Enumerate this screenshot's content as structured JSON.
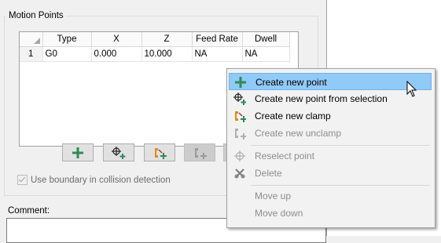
{
  "motion_points": {
    "title": "Motion Points",
    "columns": [
      "Type",
      "X",
      "Z",
      "Feed Rate",
      "Dwell"
    ],
    "rows": [
      {
        "num": "1",
        "type": "G0",
        "x": "0.000",
        "z": "10.000",
        "feed": "NA",
        "dwell": "NA"
      }
    ]
  },
  "toolbar": {
    "buttons": [
      {
        "name": "add-point-button",
        "icon": "plus-icon",
        "enabled": true
      },
      {
        "name": "point-from-selection-button",
        "icon": "crosshair-plus-icon",
        "enabled": true
      },
      {
        "name": "create-clamp-button",
        "icon": "clamp-icon",
        "enabled": true
      },
      {
        "name": "create-unclamp-button",
        "icon": "unclamp-icon",
        "enabled": false
      }
    ]
  },
  "boundary_checkbox": {
    "label": "Use boundary in collision detection",
    "checked": true,
    "enabled": false
  },
  "comment": {
    "label": "Comment:",
    "value": ""
  },
  "context_menu": {
    "items": [
      {
        "label": "Create new point",
        "icon": "plus-icon",
        "enabled": true,
        "highlighted": true
      },
      {
        "label": "Create new point from selection",
        "icon": "crosshair-plus-icon",
        "enabled": true
      },
      {
        "label": "Create new clamp",
        "icon": "clamp-icon",
        "enabled": true
      },
      {
        "label": "Create new unclamp",
        "icon": "unclamp-icon",
        "enabled": false
      },
      {
        "label": "Reselect point",
        "icon": "crosshair-icon",
        "enabled": false
      },
      {
        "label": "Delete",
        "icon": "delete-icon",
        "enabled": false
      },
      {
        "label": "Move up",
        "icon": "",
        "enabled": false
      },
      {
        "label": "Move down",
        "icon": "",
        "enabled": false
      }
    ]
  },
  "colors": {
    "menu_highlight": "#91c9f7",
    "plus_green": "#2e8b57"
  }
}
